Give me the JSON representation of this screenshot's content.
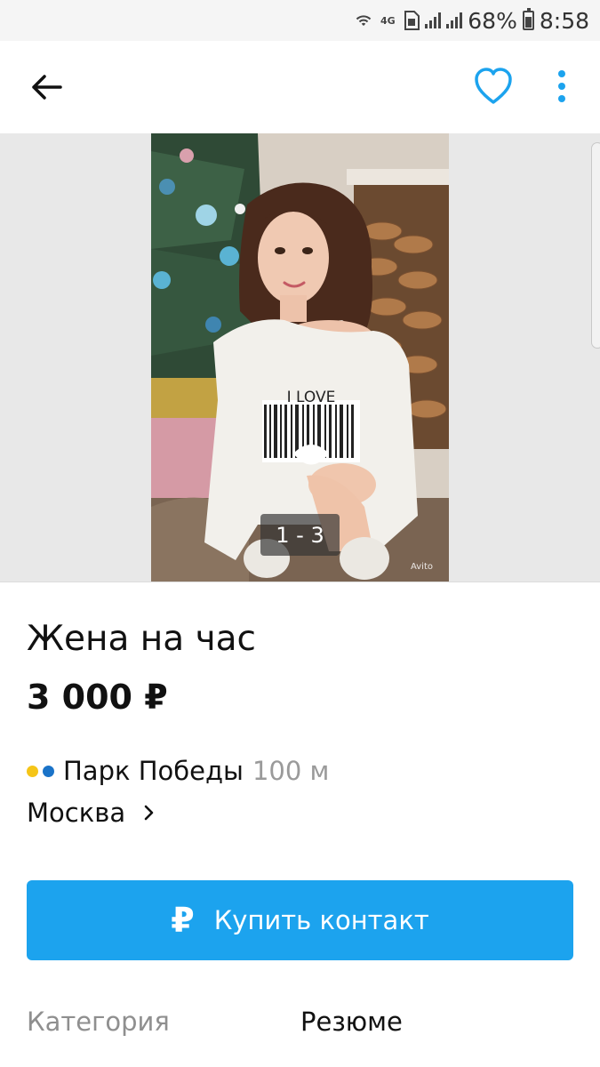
{
  "status_bar": {
    "network": "4G",
    "battery": "68%",
    "time": "8:58",
    "icons": [
      "wifi-icon",
      "network-4g-icon",
      "sim-icon",
      "signal-icon",
      "signal-icon",
      "battery-icon"
    ]
  },
  "app_bar": {
    "icons": [
      "back-arrow-icon",
      "heart-icon",
      "more-vert-icon"
    ],
    "accent": "#1ca3ee"
  },
  "gallery": {
    "counter": "1 - 3",
    "photo_text": "I LOVE",
    "watermark": "Avito"
  },
  "listing": {
    "title": "Жена на час",
    "price": "3 000 ₽",
    "metro": {
      "station": "Парк Победы",
      "distance": "100 м",
      "line_colors": [
        "#f5c518",
        "#1a73c8"
      ]
    },
    "city": "Москва"
  },
  "actions": {
    "buy_icon": "₽",
    "buy_label": "Купить контакт",
    "button_color": "#1ca3ee"
  },
  "params": {
    "category_label": "Категория",
    "category_value": "Резюме"
  }
}
